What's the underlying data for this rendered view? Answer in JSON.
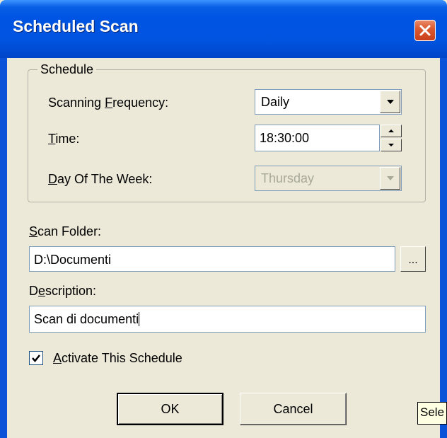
{
  "window": {
    "title": "Scheduled Scan"
  },
  "schedule": {
    "legend": "Schedule",
    "frequency": {
      "label_prefix": "Scanning ",
      "label_accel": "F",
      "label_suffix": "requency:",
      "value": "Daily"
    },
    "time": {
      "label_accel": "T",
      "label_suffix": "ime:",
      "value": "18:30:00"
    },
    "day": {
      "label_accel": "D",
      "label_suffix": "ay Of The Week:",
      "value": "Thursday"
    }
  },
  "scan_folder": {
    "label_accel": "S",
    "label_suffix": "can Folder:",
    "value": "D:\\Documenti",
    "browse_label": "..."
  },
  "description": {
    "label_prefix": "D",
    "label_accel": "e",
    "label_suffix": "scription:",
    "value": "Scan di documenti"
  },
  "activate": {
    "label_accel": "A",
    "label_suffix": "ctivate This Schedule",
    "checked": true
  },
  "buttons": {
    "ok": "OK",
    "cancel": "Cancel"
  },
  "tooltip": "Sele",
  "colors": {
    "titlebar": "#0054e3",
    "close": "#dc5a31",
    "dialog_bg": "#ece9d8"
  },
  "icons": {
    "close": "close-icon",
    "dropdown": "chevron-down-icon",
    "check": "check-icon"
  }
}
